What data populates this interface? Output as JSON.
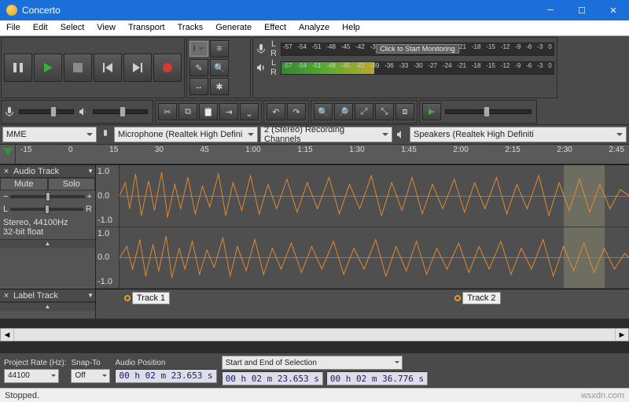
{
  "window": {
    "title": "Concerto"
  },
  "menu": [
    "File",
    "Edit",
    "Select",
    "View",
    "Transport",
    "Tracks",
    "Generate",
    "Effect",
    "Analyze",
    "Help"
  ],
  "meters": {
    "rec_overlay": "Click to Start Monitoring",
    "ticks": [
      "-57",
      "-54",
      "-51",
      "-48",
      "-45",
      "-42",
      "-39",
      "-36",
      "-33",
      "-30",
      "-27",
      "-24",
      "-21",
      "-18",
      "-15",
      "-12",
      "-9",
      "-6",
      "-3",
      "0"
    ]
  },
  "devices": {
    "host": "MME",
    "input": "Microphone (Realtek High Defini",
    "channels": "2 (Stereo) Recording Channels",
    "output": "Speakers (Realtek High Definiti"
  },
  "ruler": [
    "-15",
    "0",
    "15",
    "30",
    "45",
    "1:00",
    "1:15",
    "1:30",
    "1:45",
    "2:00",
    "2:15",
    "2:30",
    "2:45"
  ],
  "tracks": {
    "audio": {
      "name": "Audio Track",
      "mute": "Mute",
      "solo": "Solo",
      "panL": "L",
      "panR": "R",
      "format": "Stereo, 44100Hz\n32-bit float",
      "vticks": [
        "1.0",
        "0.0",
        "-1.0"
      ]
    },
    "label": {
      "name": "Label Track",
      "items": [
        "Track 1",
        "Track 2"
      ]
    }
  },
  "bottom": {
    "rate_label": "Project Rate (Hz):",
    "rate": "44100",
    "snap_label": "Snap-To",
    "snap": "Off",
    "pos_label": "Audio Position",
    "pos": "00 h 02 m 23.653 s",
    "sel_label": "Start and End of Selection",
    "sel_start": "00 h 02 m 23.653 s",
    "sel_end": "00 h 02 m 36.776 s"
  },
  "status": {
    "text": "Stopped.",
    "watermark": "wsxdn.com"
  }
}
